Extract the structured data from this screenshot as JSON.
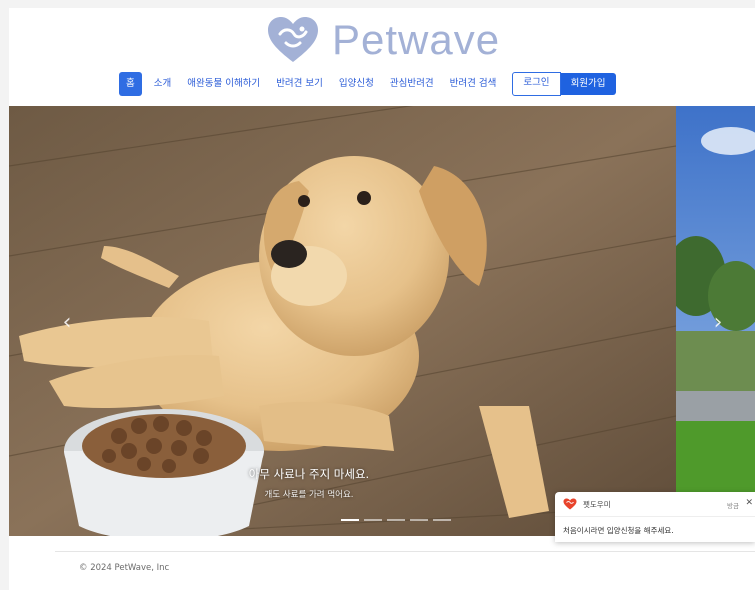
{
  "brand": {
    "name": "Petwave"
  },
  "nav": {
    "items": [
      {
        "label": "홈",
        "active": true
      },
      {
        "label": "소개"
      },
      {
        "label": "애완동물 이해하기"
      },
      {
        "label": "반려견 보기"
      },
      {
        "label": "입양신청"
      },
      {
        "label": "관심반려견"
      },
      {
        "label": "반려견 검색"
      }
    ],
    "login_label": "로그인",
    "signup_label": "회원가입"
  },
  "carousel": {
    "caption_title": "아무 사료나 주지 마세요.",
    "caption_sub": "개도 사료를 가려 먹어요.",
    "indicators": 5,
    "active_index": 0,
    "prev_icon": "chevron-left-icon",
    "next_icon": "chevron-right-icon"
  },
  "footer": {
    "copyright": "© 2024 PetWave, Inc"
  },
  "chat": {
    "name": "펫도우미",
    "status": "방금",
    "message": "처음이시라면 입양신청을 해주세요.",
    "close_icon": "close-icon"
  },
  "colors": {
    "brand": "#a3b1d6",
    "primary": "#2f6de3",
    "heart": "#e8442c"
  }
}
